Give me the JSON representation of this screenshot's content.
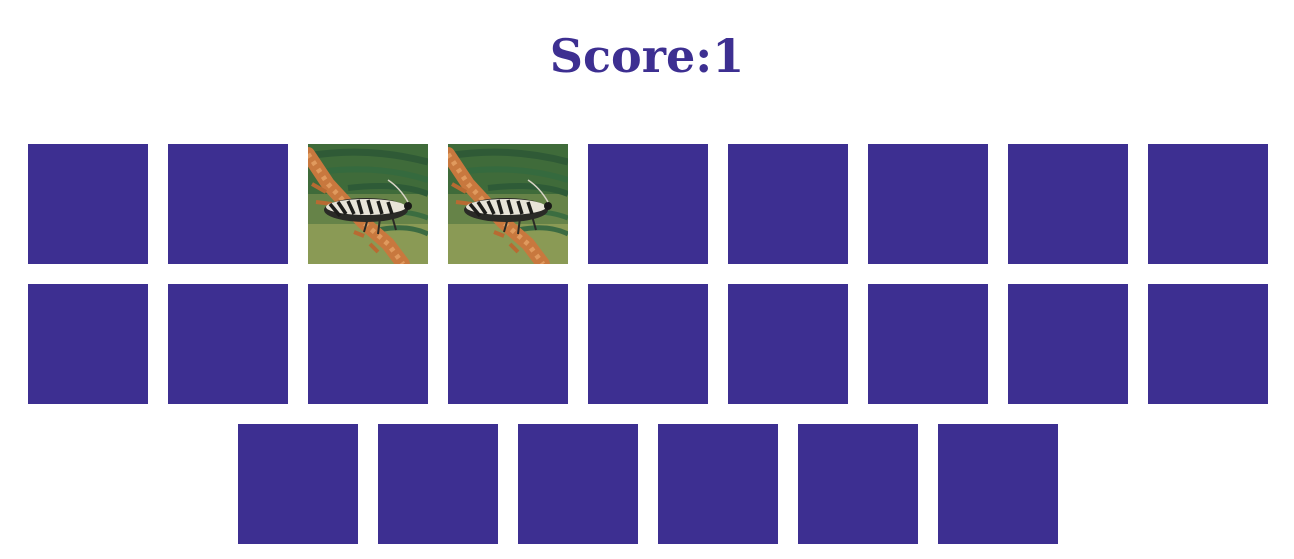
{
  "colors": {
    "accent": "#3d2f91",
    "background": "#ffffff"
  },
  "score_text": "Score:1",
  "board": {
    "cards": [
      {
        "state": "face-down"
      },
      {
        "state": "face-down"
      },
      {
        "state": "revealed",
        "image": "moth-on-branch"
      },
      {
        "state": "revealed",
        "image": "moth-on-branch"
      },
      {
        "state": "face-down"
      },
      {
        "state": "face-down"
      },
      {
        "state": "face-down"
      },
      {
        "state": "face-down"
      },
      {
        "state": "face-down"
      },
      {
        "state": "face-down"
      },
      {
        "state": "face-down"
      },
      {
        "state": "face-down"
      },
      {
        "state": "face-down"
      },
      {
        "state": "face-down"
      },
      {
        "state": "face-down"
      },
      {
        "state": "face-down"
      },
      {
        "state": "face-down"
      },
      {
        "state": "face-down"
      },
      {
        "state": "face-down"
      },
      {
        "state": "face-down"
      },
      {
        "state": "face-down"
      },
      {
        "state": "face-down"
      },
      {
        "state": "face-down"
      },
      {
        "state": "face-down"
      }
    ]
  }
}
